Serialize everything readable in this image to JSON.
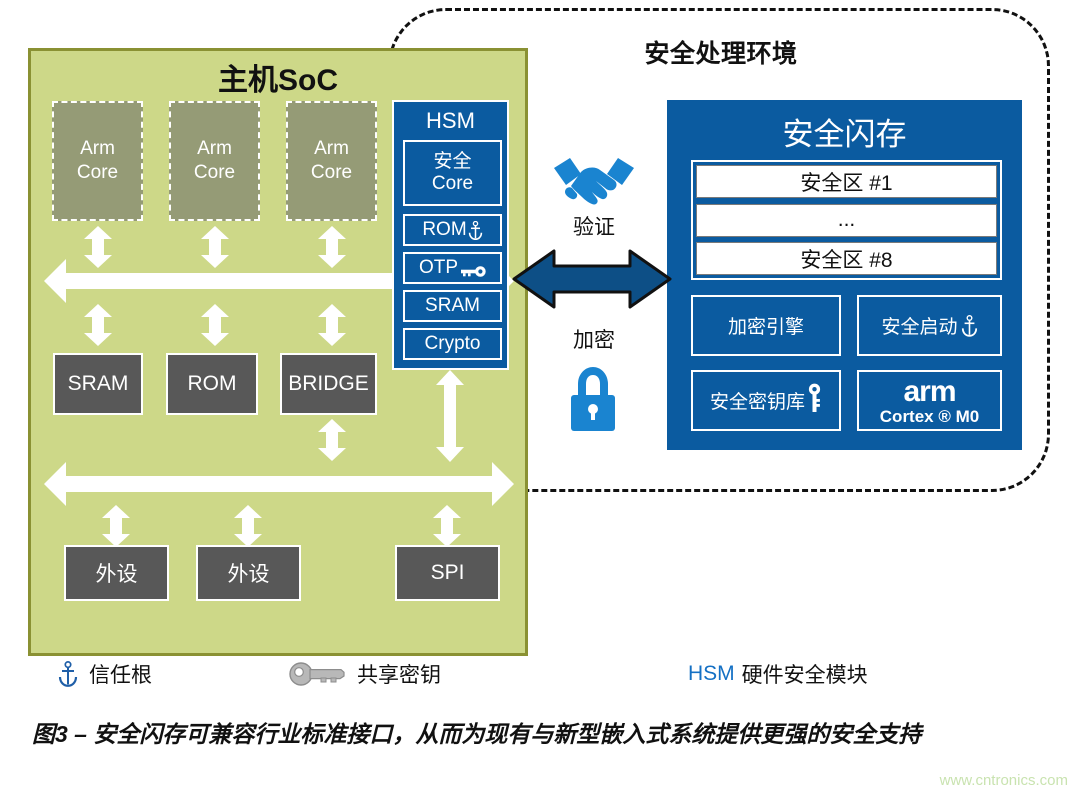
{
  "secure_env": {
    "title": "安全处理环境"
  },
  "host_soc": {
    "title": "主机SoC",
    "cores": [
      {
        "line1": "Arm",
        "line2": "Core"
      },
      {
        "line1": "Arm",
        "line2": "Core"
      },
      {
        "line1": "Arm",
        "line2": "Core"
      }
    ],
    "mid_blocks": [
      "SRAM",
      "ROM",
      "BRIDGE"
    ],
    "bottom_blocks": [
      "外设",
      "外设",
      "SPI"
    ]
  },
  "hsm": {
    "title": "HSM",
    "core": {
      "line1": "安全",
      "line2": "Core"
    },
    "cells": [
      "ROM",
      "OTP",
      "SRAM",
      "Crypto"
    ]
  },
  "link": {
    "verify_label": "验证",
    "encrypt_label": "加密",
    "handshake_icon": "handshake-icon",
    "lock_icon": "lock-icon",
    "arrow_icon": "bidirectional-arrow-icon"
  },
  "secure_flash": {
    "title": "安全闪存",
    "zones": [
      "安全区 #1",
      "...",
      "安全区 #8"
    ],
    "cells": {
      "crypto_engine": "加密引擎",
      "secure_boot": "安全启动",
      "key_store": "安全密钥库"
    },
    "arm_logo": {
      "word": "arm",
      "cortex": "Cortex ® M0"
    }
  },
  "legend": [
    {
      "icon": "anchor-icon",
      "label": "信任根"
    },
    {
      "icon": "key-icon",
      "label": "共享密钥"
    },
    {
      "abbr": "HSM",
      "label": "硬件安全模块"
    }
  ],
  "caption": "图3 – 安全闪存可兼容行业标准接口，从而为现有与新型嵌入式系统提供更强的安全支持",
  "watermark": "www.cntronics.com",
  "colors": {
    "soc_green": "#cdd888",
    "soc_border": "#8a9133",
    "core_olive": "#959b76",
    "dark_gray": "#585858",
    "blue": "#0b5ba0",
    "arrow_blue": "#0d4f86",
    "legend_blue": "#1470c4",
    "watermark_green": "#c9e3b0"
  }
}
